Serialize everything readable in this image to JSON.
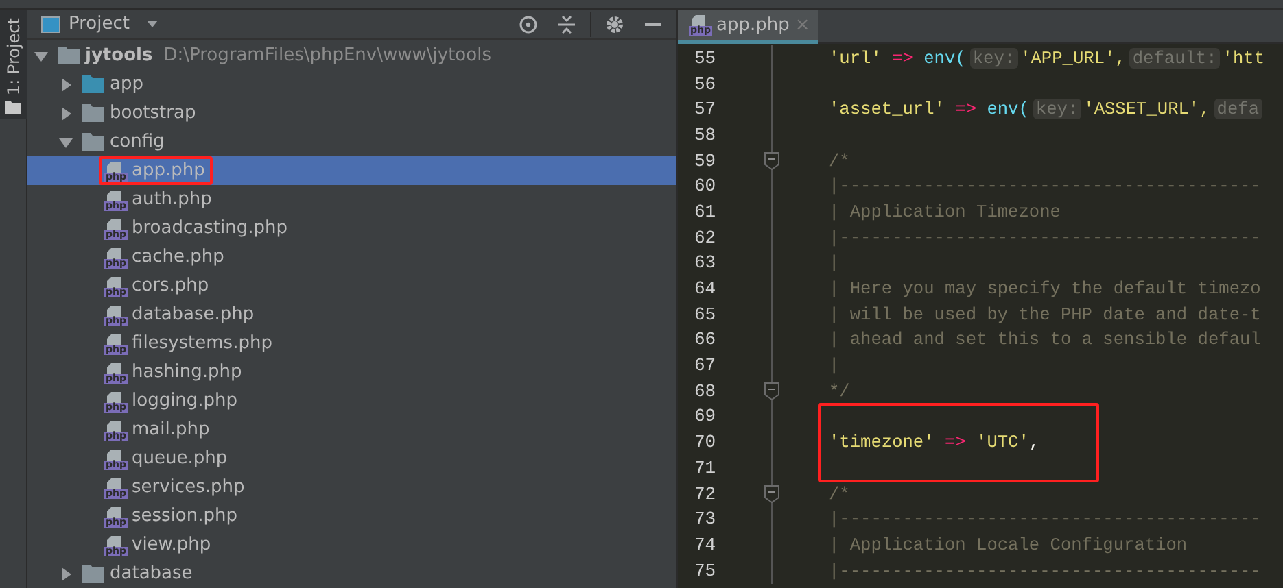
{
  "side_stripe": {
    "label": "1: Project"
  },
  "project_panel": {
    "title": "Project",
    "tree": [
      {
        "kind": "folder",
        "name": "jytools",
        "path": "D:\\ProgramFiles\\phpEnv\\www\\jytools",
        "expanded": true,
        "selected": false,
        "color": "#87939a",
        "children": [
          {
            "kind": "folder",
            "name": "app",
            "expanded": false,
            "selected": false,
            "color": "#3a8fb0"
          },
          {
            "kind": "folder",
            "name": "bootstrap",
            "expanded": false,
            "selected": false,
            "color": "#87939a"
          },
          {
            "kind": "folder",
            "name": "config",
            "expanded": true,
            "selected": false,
            "color": "#87939a",
            "children": [
              {
                "kind": "file",
                "name": "app.php",
                "icon_label": "php",
                "selected": true,
                "boxed": true
              },
              {
                "kind": "file",
                "name": "auth.php",
                "icon_label": "php",
                "selected": false,
                "boxed": false
              },
              {
                "kind": "file",
                "name": "broadcasting.php",
                "icon_label": "php",
                "selected": false,
                "boxed": false
              },
              {
                "kind": "file",
                "name": "cache.php",
                "icon_label": "php",
                "selected": false,
                "boxed": false
              },
              {
                "kind": "file",
                "name": "cors.php",
                "icon_label": "php",
                "selected": false,
                "boxed": false
              },
              {
                "kind": "file",
                "name": "database.php",
                "icon_label": "php",
                "selected": false,
                "boxed": false
              },
              {
                "kind": "file",
                "name": "filesystems.php",
                "icon_label": "php",
                "selected": false,
                "boxed": false
              },
              {
                "kind": "file",
                "name": "hashing.php",
                "icon_label": "php",
                "selected": false,
                "boxed": false
              },
              {
                "kind": "file",
                "name": "logging.php",
                "icon_label": "php",
                "selected": false,
                "boxed": false
              },
              {
                "kind": "file",
                "name": "mail.php",
                "icon_label": "php",
                "selected": false,
                "boxed": false
              },
              {
                "kind": "file",
                "name": "queue.php",
                "icon_label": "php",
                "selected": false,
                "boxed": false
              },
              {
                "kind": "file",
                "name": "services.php",
                "icon_label": "php",
                "selected": false,
                "boxed": false
              },
              {
                "kind": "file",
                "name": "session.php",
                "icon_label": "php",
                "selected": false,
                "boxed": false
              },
              {
                "kind": "file",
                "name": "view.php",
                "icon_label": "php",
                "selected": false,
                "boxed": false
              }
            ]
          },
          {
            "kind": "folder",
            "name": "database",
            "expanded": false,
            "selected": false,
            "color": "#87939a"
          }
        ]
      }
    ]
  },
  "editor": {
    "tabs": [
      {
        "label": "app.php",
        "icon_label": "php",
        "selected": true,
        "close": "×"
      }
    ],
    "lines": [
      {
        "number": "55",
        "fold": false,
        "boxed": false,
        "tokens": [
          {
            "kind": "string",
            "text": "'url'"
          },
          {
            "kind": "op",
            "text": " => "
          },
          {
            "kind": "func",
            "text": "env("
          },
          {
            "kind": "hint",
            "text": "key:"
          },
          {
            "kind": "string",
            "text": "'APP_URL',"
          },
          {
            "kind": "hint",
            "text": "default:"
          },
          {
            "kind": "string",
            "text": "'htt"
          }
        ]
      },
      {
        "number": "56",
        "fold": false,
        "boxed": false
      },
      {
        "number": "57",
        "fold": false,
        "boxed": false,
        "tokens": [
          {
            "kind": "string",
            "text": "'asset_url'"
          },
          {
            "kind": "op",
            "text": " => "
          },
          {
            "kind": "func",
            "text": "env("
          },
          {
            "kind": "hint",
            "text": "key:"
          },
          {
            "kind": "string",
            "text": "'ASSET_URL',"
          },
          {
            "kind": "hint",
            "text": "defa"
          }
        ]
      },
      {
        "number": "58",
        "fold": false,
        "boxed": false
      },
      {
        "number": "59",
        "fold": true,
        "boxed": false,
        "tokens": [
          {
            "kind": "comment",
            "text": "/*"
          }
        ]
      },
      {
        "number": "60",
        "fold": false,
        "boxed": false,
        "tokens": [
          {
            "kind": "comment",
            "text": "|----------------------------------------"
          }
        ]
      },
      {
        "number": "61",
        "fold": false,
        "boxed": false,
        "tokens": [
          {
            "kind": "comment",
            "text": "| Application Timezone"
          }
        ]
      },
      {
        "number": "62",
        "fold": false,
        "boxed": false,
        "tokens": [
          {
            "kind": "comment",
            "text": "|----------------------------------------"
          }
        ]
      },
      {
        "number": "63",
        "fold": false,
        "boxed": false,
        "tokens": [
          {
            "kind": "comment",
            "text": "|"
          }
        ]
      },
      {
        "number": "64",
        "fold": false,
        "boxed": false,
        "tokens": [
          {
            "kind": "comment",
            "text": "| Here you may specify the default timezo"
          }
        ]
      },
      {
        "number": "65",
        "fold": false,
        "boxed": false,
        "tokens": [
          {
            "kind": "comment",
            "text": "| will be used by the PHP date and date-t"
          }
        ]
      },
      {
        "number": "66",
        "fold": false,
        "boxed": false,
        "tokens": [
          {
            "kind": "comment",
            "text": "| ahead and set this to a sensible defaul"
          }
        ]
      },
      {
        "number": "67",
        "fold": false,
        "boxed": false,
        "tokens": [
          {
            "kind": "comment",
            "text": "|"
          }
        ]
      },
      {
        "number": "68",
        "fold": true,
        "boxed": false,
        "tokens": [
          {
            "kind": "comment",
            "text": "*/"
          }
        ]
      },
      {
        "number": "69",
        "fold": false,
        "boxed": true
      },
      {
        "number": "70",
        "fold": false,
        "boxed": true,
        "tokens": [
          {
            "kind": "string",
            "text": "'timezone'"
          },
          {
            "kind": "op",
            "text": " => "
          },
          {
            "kind": "string",
            "text": "'UTC'"
          },
          {
            "kind": "punct",
            "text": ","
          }
        ]
      },
      {
        "number": "71",
        "fold": false,
        "boxed": true
      },
      {
        "number": "72",
        "fold": true,
        "boxed": false,
        "tokens": [
          {
            "kind": "comment",
            "text": "/*"
          }
        ]
      },
      {
        "number": "73",
        "fold": false,
        "boxed": false,
        "tokens": [
          {
            "kind": "comment",
            "text": "|----------------------------------------"
          }
        ]
      },
      {
        "number": "74",
        "fold": false,
        "boxed": false,
        "tokens": [
          {
            "kind": "comment",
            "text": "| Application Locale Configuration"
          }
        ]
      },
      {
        "number": "75",
        "fold": false,
        "boxed": false,
        "tokens": [
          {
            "kind": "comment",
            "text": "|----------------------------------------"
          }
        ]
      }
    ]
  }
}
